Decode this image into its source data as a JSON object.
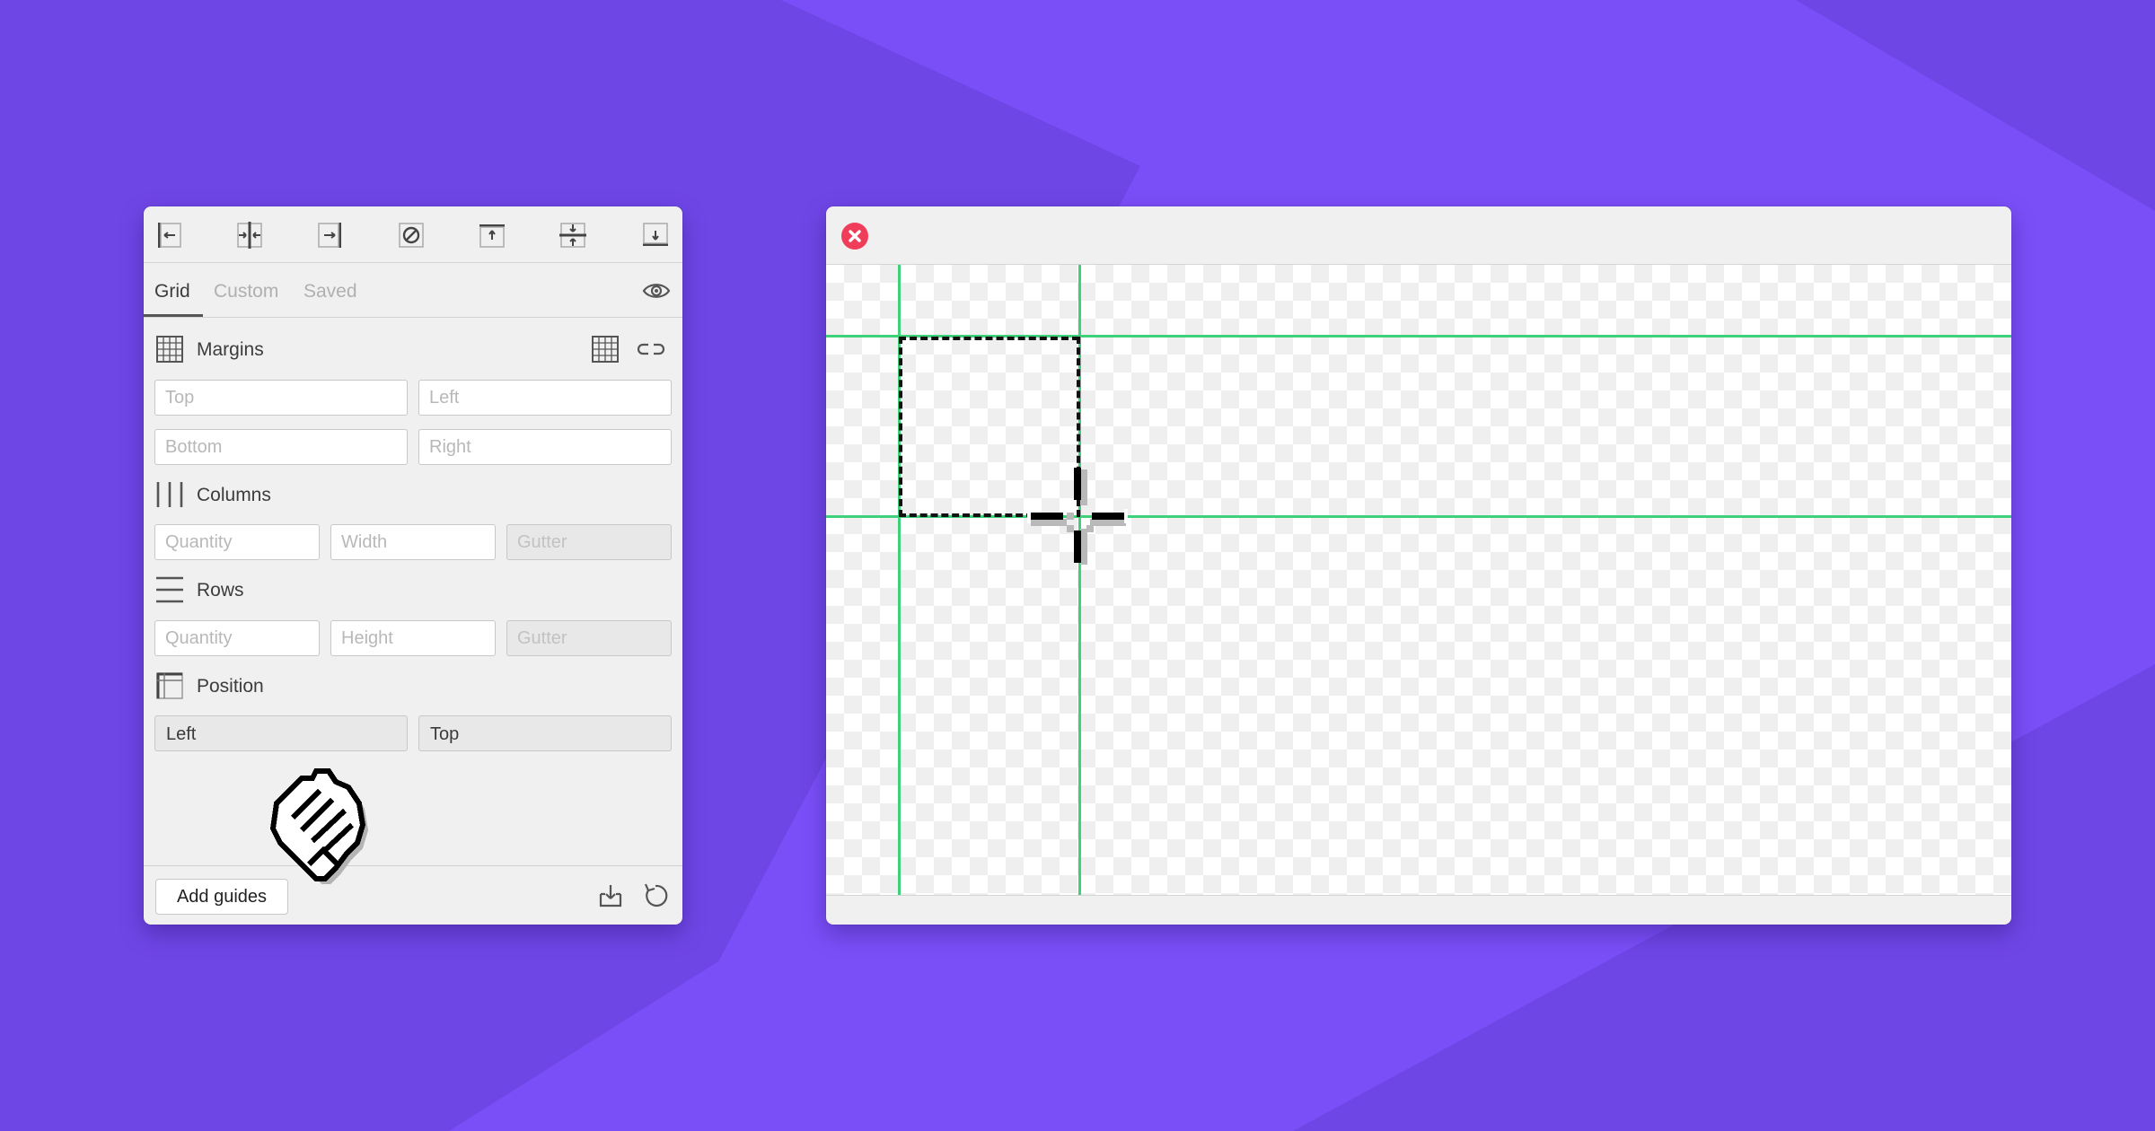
{
  "colors": {
    "background": "#7b4ff8",
    "guide": "#3fd17a",
    "close": "#ef3d5a"
  },
  "toolbar": {
    "buttons": [
      {
        "name": "align-left-icon"
      },
      {
        "name": "align-center-horizontal-icon"
      },
      {
        "name": "align-right-icon"
      },
      {
        "name": "clear-icon"
      },
      {
        "name": "align-top-icon"
      },
      {
        "name": "align-center-vertical-icon"
      },
      {
        "name": "align-bottom-icon"
      }
    ]
  },
  "tabs": [
    {
      "label": "Grid",
      "active": true
    },
    {
      "label": "Custom",
      "active": false
    },
    {
      "label": "Saved",
      "active": false
    }
  ],
  "margins": {
    "title": "Margins",
    "top_placeholder": "Top",
    "left_placeholder": "Left",
    "bottom_placeholder": "Bottom",
    "right_placeholder": "Right"
  },
  "columns": {
    "title": "Columns",
    "quantity_placeholder": "Quantity",
    "width_placeholder": "Width",
    "gutter_placeholder": "Gutter"
  },
  "rows": {
    "title": "Rows",
    "quantity_placeholder": "Quantity",
    "height_placeholder": "Height",
    "gutter_placeholder": "Gutter"
  },
  "position": {
    "title": "Position",
    "horizontal_value": "Left",
    "vertical_value": "Top"
  },
  "footer": {
    "add_label": "Add guides"
  }
}
